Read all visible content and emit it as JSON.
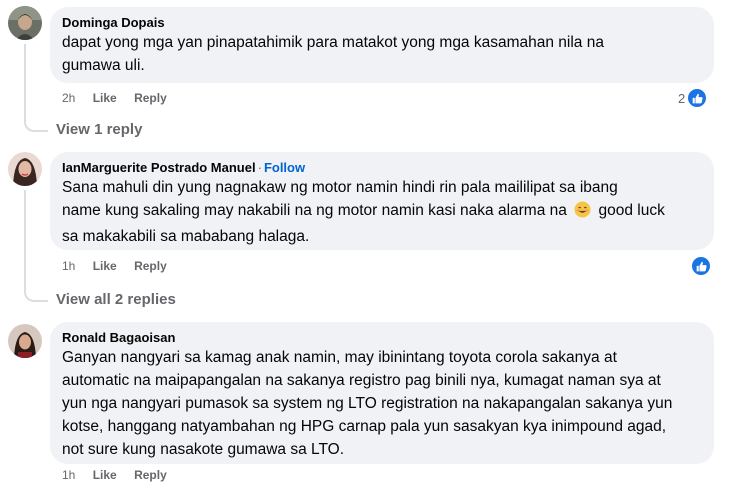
{
  "comments": [
    {
      "author": "Dominga Dopais",
      "lines": [
        "dapat yong mga yan pinapatahimik para matakot yong mga kasamahan nila na",
        "gumawa uli."
      ],
      "time": "2h",
      "like_label": "Like",
      "reply_label": "Reply",
      "reaction_count": "2",
      "view_replies": "View 1 reply"
    },
    {
      "author": "IanMarguerite Postrado Manuel",
      "follow_label": "Follow",
      "lines": [
        "Sana mahuli din yung nagnakaw ng motor namin hindi rin pala maililipat sa ibang",
        "name kung sakaling may nakabili na ng motor namin kasi naka alarma na",
        "good luck",
        "sa makakabili sa mababang halaga."
      ],
      "emoji": "smiling-face-emoji",
      "time": "1h",
      "like_label": "Like",
      "reply_label": "Reply",
      "view_replies": "View all 2 replies"
    },
    {
      "author": "Ronald Bagaoisan",
      "lines": [
        "Ganyan nangyari sa kamag anak namin, may ibinintang toyota corola sakanya at",
        "automatic na maipapangalan na sakanya registro pag binili nya, kumagat naman sya at",
        "yun nga nangyari pumasok sa system ng LTO registration na nakapangalan sakanya yun",
        "kotse, hanggang natyambahan ng HPG carnap pala yun sasakyan kya inimpound agad,",
        "not sure kung nasakote gumawa sa LTO."
      ],
      "time": "1h",
      "like_label": "Like",
      "reply_label": "Reply"
    }
  ],
  "colors": {
    "bubble": "#f0f2f5",
    "meta": "#65676b",
    "link": "#0064d1",
    "like": "#1b74e4"
  }
}
